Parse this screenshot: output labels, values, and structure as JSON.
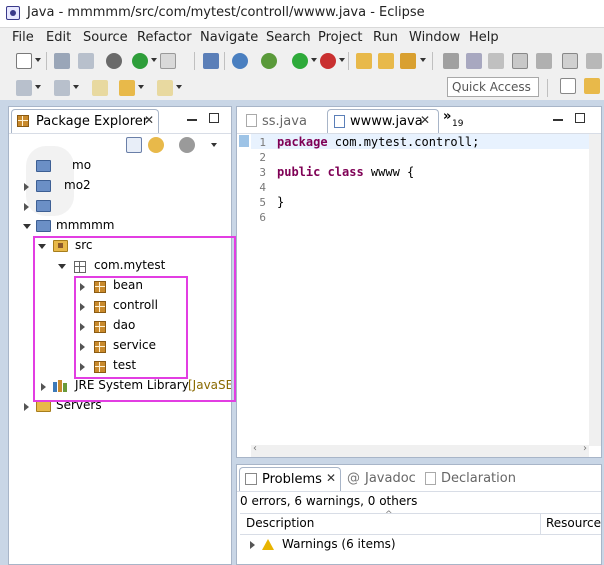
{
  "window": {
    "title": "Java - mmmmm/src/com/mytest/controll/wwww.java - Eclipse"
  },
  "menu": [
    "File",
    "Edit",
    "Source",
    "Refactor",
    "Navigate",
    "Search",
    "Project",
    "Run",
    "Window",
    "Help"
  ],
  "toolbar": {
    "quick_access_placeholder": "Quick Access"
  },
  "package_explorer": {
    "title": "Package Explorer",
    "items": [
      {
        "label": "mo"
      },
      {
        "label": "mo2"
      },
      {
        "label": ""
      },
      {
        "label": "mmmmm"
      },
      {
        "label": "src"
      },
      {
        "label": "com.mytest"
      },
      {
        "label": "bean"
      },
      {
        "label": "controll"
      },
      {
        "label": "dao"
      },
      {
        "label": "service"
      },
      {
        "label": "test"
      },
      {
        "label": "JRE System Library",
        "suffix": "[JavaSE"
      },
      {
        "label": "Servers"
      }
    ]
  },
  "editor": {
    "tabs": [
      {
        "label": "ss.java"
      },
      {
        "label": "wwww.java"
      }
    ],
    "overflow_count": "19",
    "overflow_glyph": "»",
    "line_numbers": [
      "1",
      "2",
      "3",
      "4",
      "5",
      "6"
    ],
    "lines": [
      {
        "kw": "package",
        "text": " com.mytest.controll;"
      },
      {
        "kw": "",
        "text": ""
      },
      {
        "kw": "public class",
        "text": " wwww {"
      },
      {
        "kw": "",
        "text": ""
      },
      {
        "kw": "",
        "text": "}"
      },
      {
        "kw": "",
        "text": ""
      }
    ]
  },
  "problems": {
    "tabs": [
      {
        "label": "Problems"
      },
      {
        "label": "Javadoc"
      },
      {
        "label": "Declaration"
      }
    ],
    "summary": "0 errors, 6 warnings, 0 others",
    "columns": [
      "Description",
      "Resource"
    ],
    "rows": [
      {
        "label": "Warnings (6 items)"
      }
    ]
  },
  "colors": {
    "highlight": "#e23ee2",
    "keyword": "#7f0055"
  }
}
